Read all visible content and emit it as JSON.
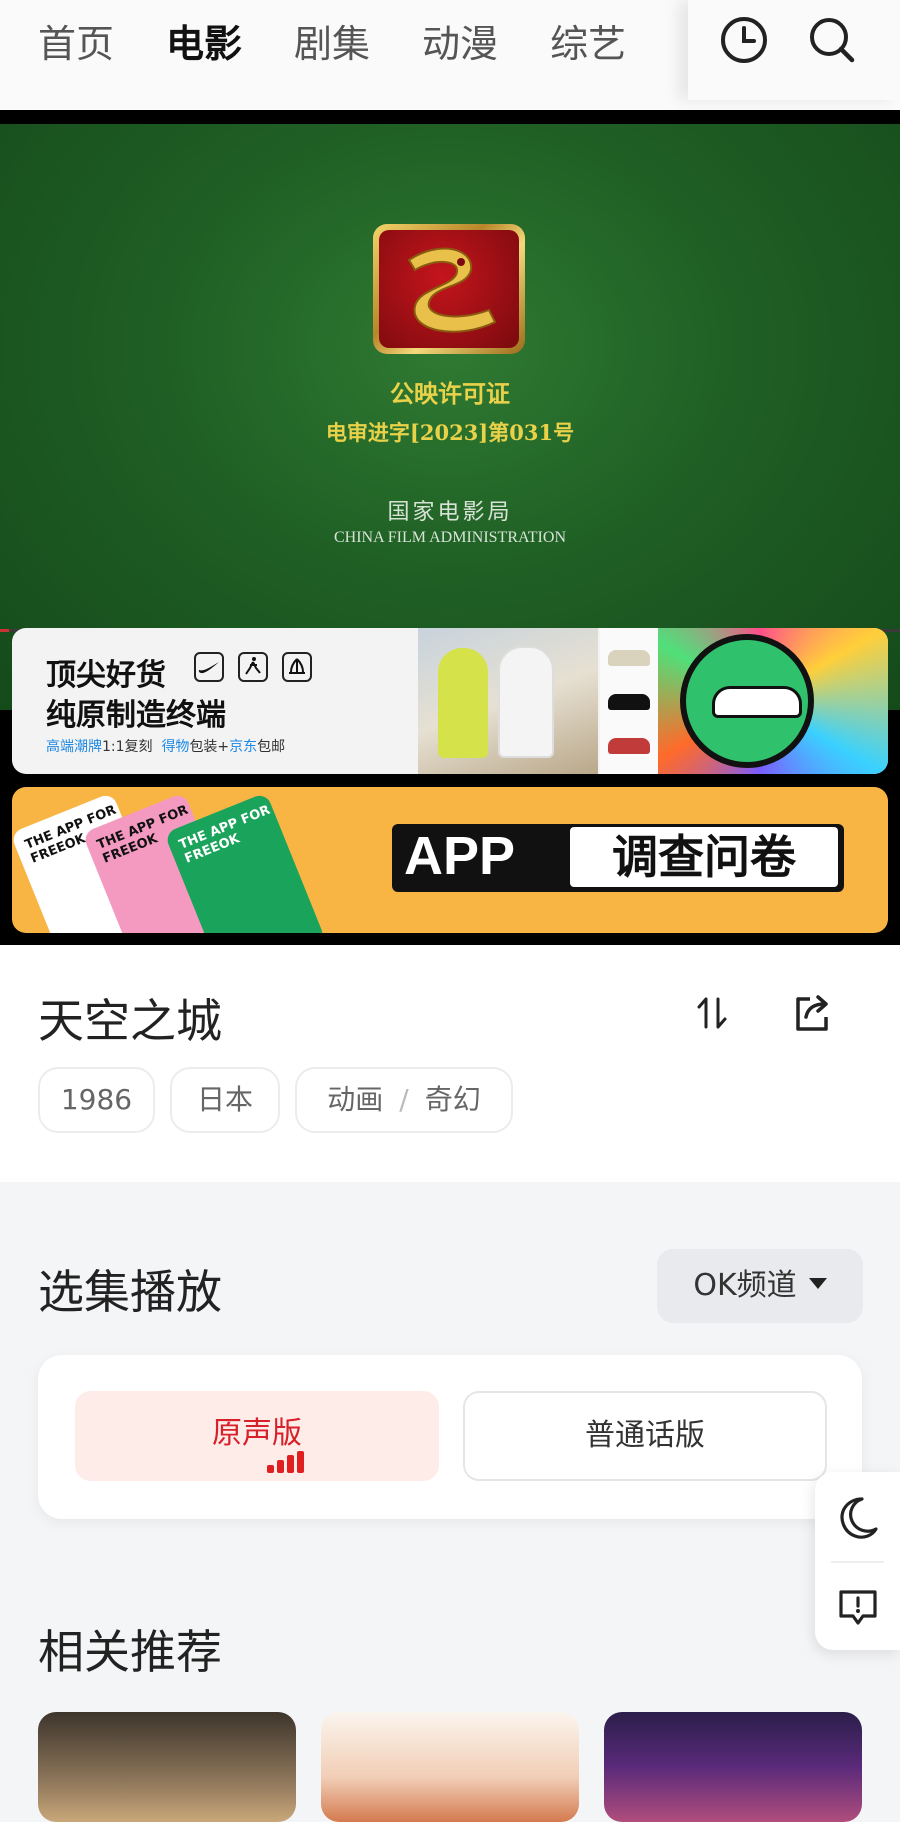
{
  "nav": {
    "tabs": [
      {
        "label": "首页",
        "active": false
      },
      {
        "label": "电影",
        "active": true
      },
      {
        "label": "剧集",
        "active": false
      },
      {
        "label": "动漫",
        "active": false
      },
      {
        "label": "综艺",
        "active": false
      }
    ],
    "icons": [
      "history-clock-icon",
      "search-icon"
    ],
    "active_underline_color": "#ffd783"
  },
  "player": {
    "license_title": "公映许可证",
    "license_number": "电审进字[2023]第031号",
    "agency_cn": "国家电影局",
    "agency_en": "CHINA FILM ADMINISTRATION",
    "progress": 0.01
  },
  "ads": {
    "sneaker": {
      "line1": "顶尖好货",
      "line2": "纯原制造终端",
      "sub_a": "高端潮牌",
      "sub_b": "1:1复刻",
      "sub_c": "得物",
      "sub_d": "包装+",
      "sub_e": "京东",
      "sub_f": "包邮"
    },
    "survey": {
      "app": "APP",
      "survey": "调查问卷",
      "card_text": "THE APP FOR FREEOK",
      "bg_color": "#f9b544"
    }
  },
  "movie": {
    "title": "天空之城",
    "tags": {
      "year": "1986",
      "region": "日本",
      "genre1": "动画",
      "genre_sep": "/",
      "genre2": "奇幻"
    }
  },
  "episodes": {
    "section_title": "选集播放",
    "channel": "OK频道",
    "options": [
      {
        "label": "原声版",
        "active": true
      },
      {
        "label": "普通话版",
        "active": false
      }
    ],
    "accent": "#d8202a"
  },
  "related": {
    "section_title": "相关推荐"
  }
}
